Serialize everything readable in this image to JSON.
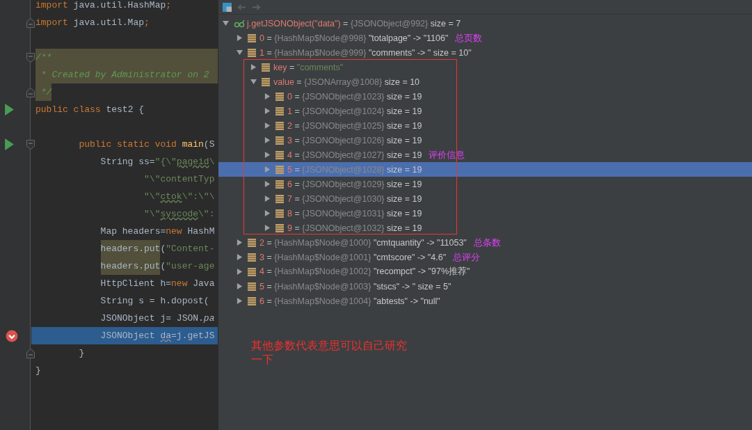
{
  "editor": {
    "lines": [
      {
        "kind": "plain",
        "run": false,
        "breakpoint": false,
        "fold_start": false,
        "fold_end": false,
        "tokens": [
          {
            "kind": "kw",
            "text": "import "
          },
          {
            "kind": "plain",
            "text": "java.util.HashMap"
          },
          {
            "kind": "kw",
            "text": ";"
          }
        ]
      },
      {
        "kind": "plain",
        "run": false,
        "breakpoint": false,
        "fold_start": false,
        "fold_end": true,
        "tokens": [
          {
            "kind": "kw",
            "text": "import "
          },
          {
            "kind": "plain",
            "text": "java.util.Map"
          },
          {
            "kind": "kw",
            "text": ";"
          }
        ]
      },
      {
        "kind": "plain",
        "run": false,
        "breakpoint": false,
        "fold_start": false,
        "fold_end": false
      },
      {
        "kind": "marked",
        "run": false,
        "breakpoint": false,
        "fold_start": true,
        "fold_end": false,
        "tokens": [
          {
            "kind": "doc",
            "text": "/**"
          }
        ]
      },
      {
        "kind": "marked",
        "run": false,
        "breakpoint": false,
        "fold_start": false,
        "fold_end": false,
        "tokens": [
          {
            "kind": "doc",
            "text": " * Created by Administrator on 2"
          }
        ]
      },
      {
        "kind": "plain",
        "run": false,
        "breakpoint": false,
        "fold_start": false,
        "fold_end": true,
        "tokens": [
          {
            "kind": "doc-marked",
            "text": " */"
          }
        ]
      },
      {
        "kind": "plain",
        "run": true,
        "breakpoint": false,
        "fold_start": false,
        "fold_end": false,
        "tokens": [
          {
            "kind": "kw",
            "text": "public class "
          },
          {
            "kind": "plain",
            "text": "test2 {"
          }
        ]
      },
      {
        "kind": "plain",
        "run": false,
        "breakpoint": false,
        "fold_start": false,
        "fold_end": false
      },
      {
        "kind": "plain",
        "run": true,
        "breakpoint": false,
        "fold_start": true,
        "fold_end": false,
        "tokens": [
          {
            "kind": "kw",
            "text": "        public static void "
          },
          {
            "kind": "method",
            "text": "main"
          },
          {
            "kind": "plain",
            "text": "(S"
          }
        ]
      },
      {
        "kind": "plain",
        "run": false,
        "breakpoint": false,
        "fold_start": false,
        "fold_end": false,
        "tokens": [
          {
            "kind": "plain",
            "text": "            String ss="
          },
          {
            "kind": "str",
            "text": "\"{\\\""
          },
          {
            "kind": "typo",
            "text": "pageid"
          },
          {
            "kind": "str",
            "text": "\\"
          }
        ]
      },
      {
        "kind": "plain",
        "run": false,
        "breakpoint": false,
        "fold_start": false,
        "fold_end": false,
        "tokens": [
          {
            "kind": "str",
            "text": "                    \"\\\"contentTyp"
          }
        ]
      },
      {
        "kind": "plain",
        "run": false,
        "breakpoint": false,
        "fold_start": false,
        "fold_end": false,
        "tokens": [
          {
            "kind": "str",
            "text": "                    \"\\\""
          },
          {
            "kind": "typo",
            "text": "ctok"
          },
          {
            "kind": "str",
            "text": "\\\":\\\"\\"
          }
        ]
      },
      {
        "kind": "plain",
        "run": false,
        "breakpoint": false,
        "fold_start": false,
        "fold_end": false,
        "tokens": [
          {
            "kind": "str",
            "text": "                    \"\\\""
          },
          {
            "kind": "typo",
            "text": "syscode"
          },
          {
            "kind": "str",
            "text": "\\\":"
          }
        ]
      },
      {
        "kind": "plain",
        "run": false,
        "breakpoint": false,
        "fold_start": false,
        "fold_end": false,
        "tokens": [
          {
            "kind": "plain",
            "text": "            Map headers="
          },
          {
            "kind": "kw",
            "text": "new "
          },
          {
            "kind": "plain",
            "text": "HashM"
          }
        ]
      },
      {
        "kind": "plain",
        "run": false,
        "breakpoint": false,
        "fold_start": false,
        "fold_end": false,
        "indent": true,
        "tokens": [
          {
            "kind": "marked",
            "text": "headers.put"
          },
          {
            "kind": "plain",
            "text": "("
          },
          {
            "kind": "str",
            "text": "\"Content-"
          }
        ]
      },
      {
        "kind": "plain",
        "run": false,
        "breakpoint": false,
        "fold_start": false,
        "fold_end": false,
        "indent": true,
        "tokens": [
          {
            "kind": "marked",
            "text": "headers.put"
          },
          {
            "kind": "plain",
            "text": "("
          },
          {
            "kind": "str",
            "text": "\"user-age"
          }
        ]
      },
      {
        "kind": "plain",
        "run": false,
        "breakpoint": false,
        "fold_start": false,
        "fold_end": false,
        "tokens": [
          {
            "kind": "plain",
            "text": "            HttpClient h="
          },
          {
            "kind": "kw",
            "text": "new "
          },
          {
            "kind": "plain",
            "text": "Java"
          }
        ]
      },
      {
        "kind": "plain",
        "run": false,
        "breakpoint": false,
        "fold_start": false,
        "fold_end": false,
        "tokens": [
          {
            "kind": "plain",
            "text": "            String s = h.dopost("
          }
        ]
      },
      {
        "kind": "plain",
        "run": false,
        "breakpoint": false,
        "fold_start": false,
        "fold_end": false,
        "tokens": [
          {
            "kind": "plain",
            "text": "            JSONObject j= JSON."
          },
          {
            "kind": "italic",
            "text": "pa"
          }
        ]
      },
      {
        "kind": "current",
        "run": false,
        "breakpoint": true,
        "fold_start": false,
        "fold_end": false,
        "tokens": [
          {
            "kind": "plain",
            "text": "            JSONObject "
          },
          {
            "kind": "warn",
            "text": "da"
          },
          {
            "kind": "plain",
            "text": "=j.getJS"
          }
        ]
      },
      {
        "kind": "plain",
        "run": false,
        "breakpoint": false,
        "fold_start": false,
        "fold_end": true,
        "tokens": [
          {
            "kind": "plain",
            "text": "        }"
          }
        ]
      },
      {
        "kind": "plain",
        "run": false,
        "breakpoint": false,
        "fold_start": false,
        "fold_end": false,
        "tokens": [
          {
            "kind": "plain",
            "text": "}"
          }
        ]
      }
    ]
  },
  "debugger": {
    "root": {
      "kind": "watch",
      "name": "j.getJSONObject(\"data\")",
      "eq": "=",
      "type": "{JSONObject@992}",
      "value": "size = 7",
      "expanded": true,
      "selected": false,
      "children": [
        {
          "kind": "field",
          "name": "0",
          "eq": "=",
          "type": "{HashMap$Node@998}",
          "value": "\"totalpage\" -> \"1106\"",
          "expanded": false,
          "selected": false,
          "note": "总页数"
        },
        {
          "kind": "field",
          "name": "1",
          "eq": "=",
          "type": "{HashMap$Node@999}",
          "value": "\"comments\" -> \" size = 10\"",
          "expanded": true,
          "selected": false,
          "children": [
            {
              "kind": "key",
              "name": "key",
              "eq": "=",
              "value": "\"comments\"",
              "expanded": false,
              "selected": false
            },
            {
              "kind": "field",
              "name": "value",
              "eq": "=",
              "type": "{JSONArray@1008}",
              "value": "size = 10",
              "expanded": true,
              "selected": false,
              "children": [
                {
                  "kind": "field",
                  "name": "0",
                  "eq": "=",
                  "type": "{JSONObject@1023}",
                  "value": "size = 19",
                  "expanded": false,
                  "selected": false
                },
                {
                  "kind": "field",
                  "name": "1",
                  "eq": "=",
                  "type": "{JSONObject@1024}",
                  "value": "size = 19",
                  "expanded": false,
                  "selected": false
                },
                {
                  "kind": "field",
                  "name": "2",
                  "eq": "=",
                  "type": "{JSONObject@1025}",
                  "value": "size = 19",
                  "expanded": false,
                  "selected": false
                },
                {
                  "kind": "field",
                  "name": "3",
                  "eq": "=",
                  "type": "{JSONObject@1026}",
                  "value": "size = 19",
                  "expanded": false,
                  "selected": false
                },
                {
                  "kind": "field",
                  "name": "4",
                  "eq": "=",
                  "type": "{JSONObject@1027}",
                  "value": "size = 19",
                  "expanded": false,
                  "selected": false,
                  "note": "评价信息"
                },
                {
                  "kind": "field",
                  "name": "5",
                  "eq": "=",
                  "type": "{JSONObject@1028}",
                  "value": "size = 19",
                  "expanded": false,
                  "selected": true
                },
                {
                  "kind": "field",
                  "name": "6",
                  "eq": "=",
                  "type": "{JSONObject@1029}",
                  "value": "size = 19",
                  "expanded": false,
                  "selected": false
                },
                {
                  "kind": "field",
                  "name": "7",
                  "eq": "=",
                  "type": "{JSONObject@1030}",
                  "value": "size = 19",
                  "expanded": false,
                  "selected": false
                },
                {
                  "kind": "field",
                  "name": "8",
                  "eq": "=",
                  "type": "{JSONObject@1031}",
                  "value": "size = 19",
                  "expanded": false,
                  "selected": false
                },
                {
                  "kind": "field",
                  "name": "9",
                  "eq": "=",
                  "type": "{JSONObject@1032}",
                  "value": "size = 19",
                  "expanded": false,
                  "selected": false
                }
              ]
            }
          ]
        },
        {
          "kind": "field",
          "name": "2",
          "eq": "=",
          "type": "{HashMap$Node@1000}",
          "value": "\"cmtquantity\" -> \"11053\"",
          "expanded": false,
          "selected": false,
          "note": "总条数"
        },
        {
          "kind": "field",
          "name": "3",
          "eq": "=",
          "type": "{HashMap$Node@1001}",
          "value": "\"cmtscore\" -> \"4.6\"",
          "expanded": false,
          "selected": false,
          "note": "总评分"
        },
        {
          "kind": "field",
          "name": "4",
          "eq": "=",
          "type": "{HashMap$Node@1002}",
          "value": "\"recompct\" -> \"97%推荐\"",
          "expanded": false,
          "selected": false
        },
        {
          "kind": "field",
          "name": "5",
          "eq": "=",
          "type": "{HashMap$Node@1003}",
          "value": "\"stscs\" -> \" size = 5\"",
          "expanded": false,
          "selected": false
        },
        {
          "kind": "field",
          "name": "6",
          "eq": "=",
          "type": "{HashMap$Node@1004}",
          "value": "\"abtests\" -> \"null\"",
          "expanded": false,
          "selected": false
        }
      ]
    },
    "footnote": "其他参数代表意思可以自己研究一下"
  }
}
